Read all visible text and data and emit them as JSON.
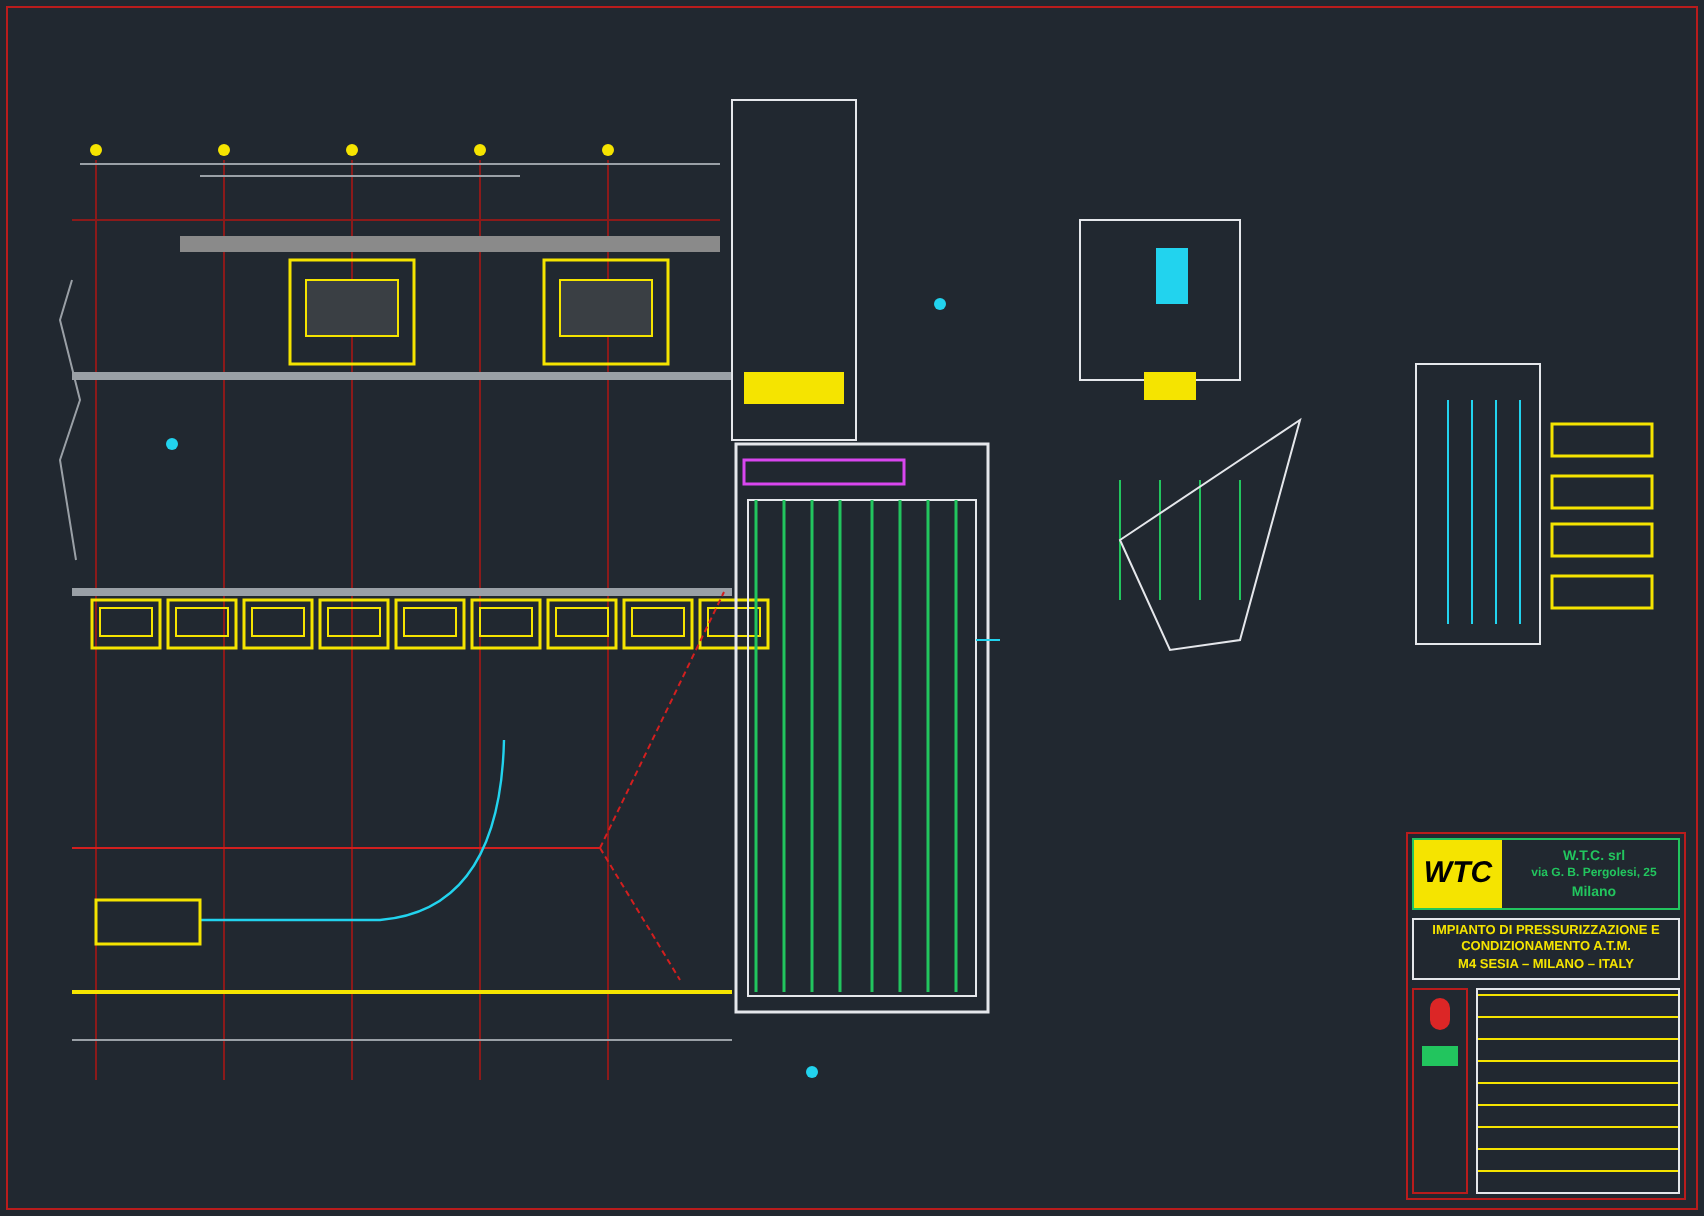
{
  "title_block": {
    "logo": "WTC",
    "company": "W.T.C. srl",
    "address": "via G. B. Pergolesi, 25",
    "city": "Milano",
    "project": "IMPIANTO DI PRESSURIZZAZIONE E CONDIZIONAMENTO A.T.M.",
    "location": "M4 SESIA – MILANO – ITALY"
  }
}
